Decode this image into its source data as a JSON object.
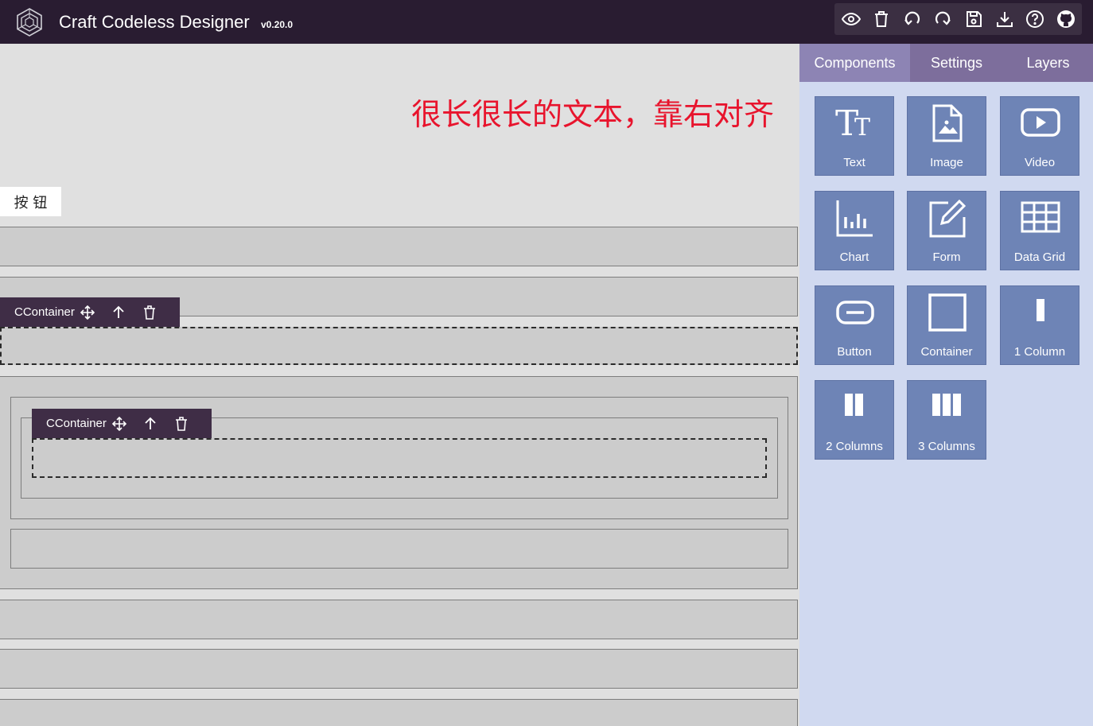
{
  "header": {
    "app_title": "Craft Codeless Designer",
    "version": "v0.20.0",
    "toolbar_icons": [
      "preview-eye-icon",
      "trash-icon",
      "undo-icon",
      "redo-icon",
      "save-icon",
      "download-icon",
      "help-icon",
      "github-icon"
    ]
  },
  "canvas": {
    "long_text": "很长很长的文本，靠右对齐",
    "long_text_color": "#e8142d",
    "button_label": "按 钮",
    "selection_bars": [
      {
        "label": "CContainer"
      },
      {
        "label": "CContainer"
      }
    ]
  },
  "panel": {
    "tabs": [
      {
        "label": "Components",
        "active": true
      },
      {
        "label": "Settings",
        "active": false
      },
      {
        "label": "Layers",
        "active": false
      }
    ],
    "components": [
      {
        "label": "Text",
        "icon": "text-icon"
      },
      {
        "label": "Image",
        "icon": "image-icon"
      },
      {
        "label": "Video",
        "icon": "video-icon"
      },
      {
        "label": "Chart",
        "icon": "chart-icon"
      },
      {
        "label": "Form",
        "icon": "form-icon"
      },
      {
        "label": "Data Grid",
        "icon": "data-grid-icon"
      },
      {
        "label": "Button",
        "icon": "button-icon"
      },
      {
        "label": "Container",
        "icon": "container-icon"
      },
      {
        "label": "1 Column",
        "icon": "one-column-icon"
      },
      {
        "label": "2 Columns",
        "icon": "two-columns-icon"
      },
      {
        "label": "3 Columns",
        "icon": "three-columns-icon"
      }
    ]
  },
  "colors": {
    "header_bg": "#291c31",
    "tab_bar": "#7d6e9c",
    "component_tile": "#6e84b6",
    "panel_bg": "#d0d9f0",
    "selection_bar": "#3f2d46"
  }
}
